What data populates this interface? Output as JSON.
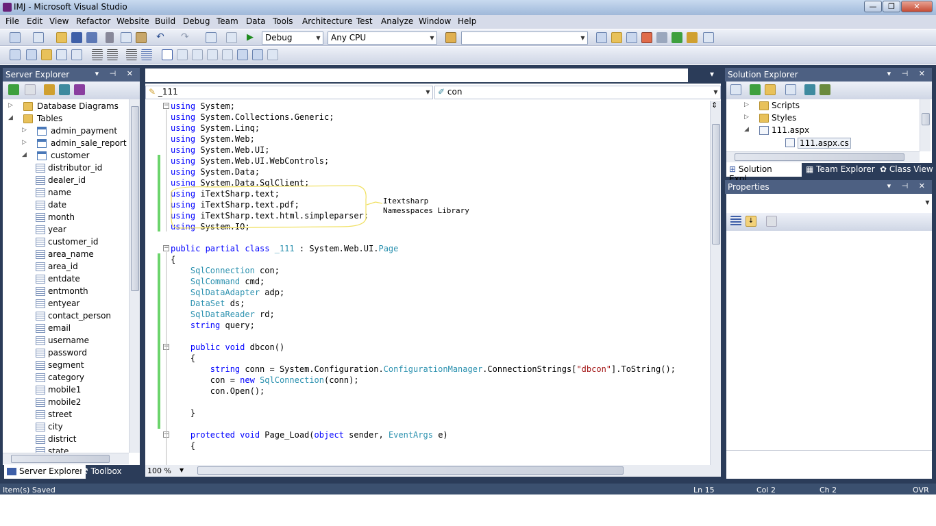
{
  "window": {
    "title": "IMJ - Microsoft Visual Studio",
    "min": "—",
    "max": "❐",
    "close": "✕"
  },
  "menu": [
    "File",
    "Edit",
    "View",
    "Refactor",
    "Website",
    "Build",
    "Debug",
    "Team",
    "Data",
    "Tools",
    "Architecture",
    "Test",
    "Analyze",
    "Window",
    "Help"
  ],
  "toolbar": {
    "config": "Debug",
    "platform": "Any CPU",
    "find": ""
  },
  "server_explorer": {
    "title": "Server Explorer",
    "header_btns": "▾ ⊣ ✕",
    "items": [
      {
        "label": "Database Diagrams",
        "kind": "folder",
        "exp": "▷"
      },
      {
        "label": "Tables",
        "kind": "folder",
        "exp": "◢"
      },
      {
        "label": "admin_payment",
        "kind": "table",
        "exp": "▷"
      },
      {
        "label": "admin_sale_report",
        "kind": "table",
        "exp": "▷"
      },
      {
        "label": "customer",
        "kind": "table",
        "exp": "◢"
      },
      {
        "label": "distributor_id",
        "kind": "col"
      },
      {
        "label": "dealer_id",
        "kind": "col"
      },
      {
        "label": "name",
        "kind": "col"
      },
      {
        "label": "date",
        "kind": "col"
      },
      {
        "label": "month",
        "kind": "col"
      },
      {
        "label": "year",
        "kind": "col"
      },
      {
        "label": "customer_id",
        "kind": "col"
      },
      {
        "label": "area_name",
        "kind": "col"
      },
      {
        "label": "area_id",
        "kind": "col"
      },
      {
        "label": "entdate",
        "kind": "col"
      },
      {
        "label": "entmonth",
        "kind": "col"
      },
      {
        "label": "entyear",
        "kind": "col"
      },
      {
        "label": "contact_person",
        "kind": "col"
      },
      {
        "label": "email",
        "kind": "col"
      },
      {
        "label": "username",
        "kind": "col"
      },
      {
        "label": "password",
        "kind": "col"
      },
      {
        "label": "segment",
        "kind": "col"
      },
      {
        "label": "category",
        "kind": "col"
      },
      {
        "label": "mobile1",
        "kind": "col"
      },
      {
        "label": "mobile2",
        "kind": "col"
      },
      {
        "label": "street",
        "kind": "col"
      },
      {
        "label": "city",
        "kind": "col"
      },
      {
        "label": "district",
        "kind": "col"
      },
      {
        "label": "state",
        "kind": "col"
      }
    ],
    "tabs": [
      "Server Explorer",
      "Toolbox"
    ]
  },
  "editor": {
    "class_combo": "_111",
    "member_combo": "con",
    "zoom": "100 %",
    "annotation": [
      "Itextsharp",
      "Namesspaces Library"
    ],
    "lines": [
      [
        [
          "kw",
          "using"
        ],
        [
          "",
          "System;"
        ]
      ],
      [
        [
          "kw",
          "using"
        ],
        [
          "",
          "System.Collections.Generic;"
        ]
      ],
      [
        [
          "kw",
          "using"
        ],
        [
          "",
          "System.Linq;"
        ]
      ],
      [
        [
          "kw",
          "using"
        ],
        [
          "",
          "System.Web;"
        ]
      ],
      [
        [
          "kw",
          "using"
        ],
        [
          "",
          "System.Web.UI;"
        ]
      ],
      [
        [
          "kw",
          "using"
        ],
        [
          "",
          "System.Web.UI.WebControls;"
        ]
      ],
      [
        [
          "kw",
          "using"
        ],
        [
          "",
          "System.Data;"
        ]
      ],
      [
        [
          "kw",
          "using"
        ],
        [
          "",
          "System.Data.SqlClient;"
        ]
      ],
      [
        [
          "kw",
          "using"
        ],
        [
          "",
          "iTextSharp.text;"
        ]
      ],
      [
        [
          "kw",
          "using"
        ],
        [
          "",
          "iTextSharp.text.pdf;"
        ]
      ],
      [
        [
          "kw",
          "using"
        ],
        [
          "",
          "iTextSharp.text.html.simpleparser;"
        ]
      ],
      [
        [
          "kw",
          "using"
        ],
        [
          "",
          "System.IO;"
        ]
      ],
      [],
      [
        [
          "kw",
          "public partial class"
        ],
        [
          "ty",
          "_111"
        ],
        [
          "",
          " : System.Web.UI."
        ],
        [
          "ty",
          "Page"
        ]
      ],
      [
        [
          "",
          "{"
        ]
      ],
      [
        [
          "",
          "    "
        ],
        [
          "ty",
          "SqlConnection"
        ],
        [
          "",
          " con;"
        ]
      ],
      [
        [
          "",
          "    "
        ],
        [
          "ty",
          "SqlCommand"
        ],
        [
          "",
          " cmd;"
        ]
      ],
      [
        [
          "",
          "    "
        ],
        [
          "ty",
          "SqlDataAdapter"
        ],
        [
          "",
          " adp;"
        ]
      ],
      [
        [
          "",
          "    "
        ],
        [
          "ty",
          "DataSet"
        ],
        [
          "",
          " ds;"
        ]
      ],
      [
        [
          "",
          "    "
        ],
        [
          "ty",
          "SqlDataReader"
        ],
        [
          "",
          " rd;"
        ]
      ],
      [
        [
          "",
          "    "
        ],
        [
          "kw",
          "string"
        ],
        [
          "",
          " query;"
        ]
      ],
      [],
      [
        [
          "",
          "    "
        ],
        [
          "kw",
          "public void"
        ],
        [
          "",
          " dbcon()"
        ]
      ],
      [
        [
          "",
          "    {"
        ]
      ],
      [
        [
          "",
          "        "
        ],
        [
          "kw",
          "string"
        ],
        [
          "",
          " conn = System.Configuration."
        ],
        [
          "ty",
          "ConfigurationManager"
        ],
        [
          "",
          ".ConnectionStrings["
        ],
        [
          "st",
          "\"dbcon\""
        ],
        [
          "",
          "].ToString();"
        ]
      ],
      [
        [
          "",
          "        con = "
        ],
        [
          "kw",
          "new"
        ],
        [
          "",
          " "
        ],
        [
          "ty",
          "SqlConnection"
        ],
        [
          "",
          "(conn);"
        ]
      ],
      [
        [
          "",
          "        con.Open();"
        ]
      ],
      [],
      [
        [
          "",
          "    }"
        ]
      ],
      [],
      [
        [
          "",
          "    "
        ],
        [
          "kw",
          "protected void"
        ],
        [
          "",
          " Page_Load("
        ],
        [
          "kw",
          "object"
        ],
        [
          "",
          " sender, "
        ],
        [
          "ty",
          "EventArgs"
        ],
        [
          "",
          " e)"
        ]
      ],
      [
        [
          "",
          "    {"
        ]
      ]
    ]
  },
  "solution_explorer": {
    "title": "Solution Explorer",
    "items": [
      {
        "label": "Scripts",
        "kind": "folder",
        "exp": "▷"
      },
      {
        "label": "Styles",
        "kind": "folder",
        "exp": "▷"
      },
      {
        "label": "111.aspx",
        "kind": "file",
        "exp": "◢"
      },
      {
        "label": "111.aspx.cs",
        "kind": "file"
      }
    ],
    "tabs": [
      "Solution Expl...",
      "Team Explorer",
      "Class View"
    ]
  },
  "properties": {
    "title": "Properties",
    "combo": ""
  },
  "status": {
    "message": "Item(s) Saved",
    "ln": "Ln 15",
    "col": "Col 2",
    "ch": "Ch 2",
    "mode": "OVR"
  }
}
